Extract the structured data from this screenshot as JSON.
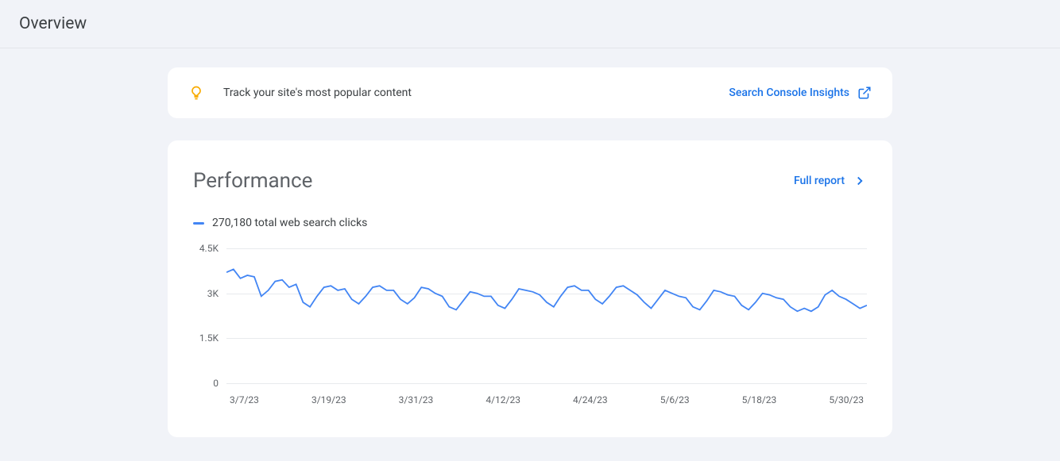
{
  "header": {
    "title": "Overview"
  },
  "insights": {
    "text": "Track your site's most popular content",
    "link_label": "Search Console Insights"
  },
  "performance": {
    "title": "Performance",
    "full_report_label": "Full report",
    "legend_text": "270,180 total web search clicks"
  },
  "chart_data": {
    "type": "line",
    "title": "",
    "xlabel": "",
    "ylabel": "",
    "ylim": [
      0,
      4500
    ],
    "y_ticks": [
      "0",
      "1.5K",
      "3K",
      "4.5K"
    ],
    "x_ticks": [
      "3/7/23",
      "3/19/23",
      "3/31/23",
      "4/12/23",
      "4/24/23",
      "5/6/23",
      "5/18/23",
      "5/30/23"
    ],
    "series": [
      {
        "name": "Total web search clicks",
        "values": [
          3700,
          3800,
          3500,
          3600,
          3550,
          2900,
          3100,
          3400,
          3450,
          3200,
          3300,
          2700,
          2550,
          2900,
          3200,
          3250,
          3100,
          3150,
          2800,
          2650,
          2900,
          3200,
          3250,
          3100,
          3100,
          2800,
          2650,
          2850,
          3200,
          3150,
          3000,
          2900,
          2550,
          2450,
          2750,
          3050,
          3000,
          2900,
          2900,
          2600,
          2500,
          2800,
          3150,
          3100,
          3050,
          2950,
          2700,
          2550,
          2900,
          3200,
          3250,
          3100,
          3100,
          2800,
          2650,
          2900,
          3200,
          3250,
          3100,
          2950,
          2700,
          2500,
          2800,
          3100,
          3000,
          2900,
          2850,
          2550,
          2450,
          2750,
          3100,
          3050,
          2950,
          2900,
          2600,
          2450,
          2700,
          3000,
          2950,
          2850,
          2800,
          2550,
          2400,
          2500,
          2400,
          2550,
          2950,
          3100,
          2900,
          2800,
          2650,
          2500,
          2600
        ]
      }
    ]
  }
}
